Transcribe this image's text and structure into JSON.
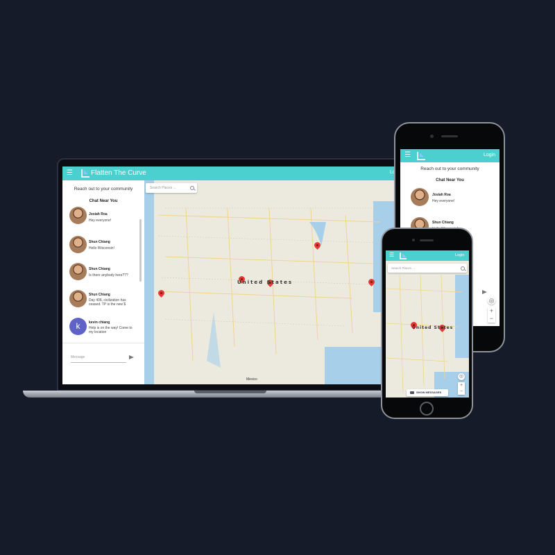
{
  "colors": {
    "background": "#161b2a",
    "accent": "#4ccfcf",
    "pin": "#e53935",
    "map_land": "#eceadf",
    "map_water": "#a7cfe9"
  },
  "laptop": {
    "app_title": "Flatten The Curve",
    "login_label": "Lo",
    "sidebar": {
      "heading": "Reach out to your community",
      "subheading": "Chat Near You",
      "chats": [
        {
          "name": "Josiah Roa",
          "message": "Hey everyone!",
          "avatar": "photo"
        },
        {
          "name": "Shun Chiang",
          "message": "Hello Wisconsin!",
          "avatar": "photo"
        },
        {
          "name": "Shun Chiang",
          "message": "Is there anybody here???",
          "avatar": "photo"
        },
        {
          "name": "Shun Chiang",
          "message": "Day 408, civilization has ceased. TP is the new $",
          "avatar": "photo"
        },
        {
          "name": "kevin chiang",
          "message": "Help is on the way! Come to my location",
          "avatar": "letter",
          "letter": "k"
        }
      ],
      "message_placeholder": "Message"
    },
    "map": {
      "search_placeholder": "Search Places ...",
      "country_label": "United States",
      "mexico_label": "Mexico"
    }
  },
  "phone_large": {
    "login_label": "Login",
    "heading": "Reach out to your community",
    "subheading": "Chat Near You",
    "chats": [
      {
        "name": "Josiah Roa",
        "message": "Hey everyone!"
      },
      {
        "name": "Shun Chiang",
        "message": "Hello Wisconsin!"
      }
    ]
  },
  "phone_small": {
    "login_label": "Login",
    "search_placeholder": "Search Places ...",
    "country_label": "United States",
    "show_messages_label": "SHOW MESSAGES"
  },
  "icons": [
    "menu-icon",
    "logo-icon",
    "search-icon",
    "send-icon",
    "location-icon",
    "zoom-in-icon",
    "zoom-out-icon",
    "map-pin-icon",
    "chat-icon"
  ]
}
